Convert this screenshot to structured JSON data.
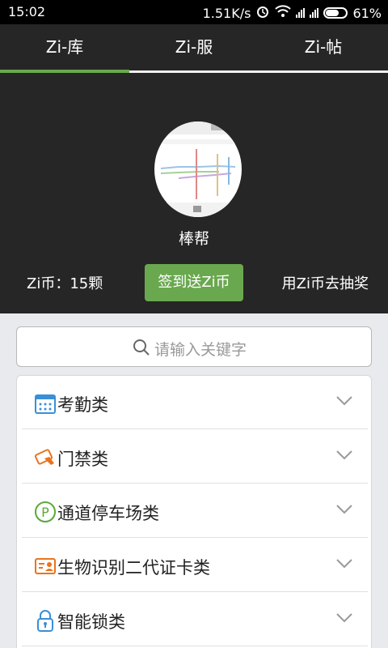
{
  "status_bar": {
    "time": "15:02",
    "speed": "1.51K/s",
    "battery": "61%"
  },
  "tabs": [
    "Zi-库",
    "Zi-服",
    "Zi-帖"
  ],
  "header": {
    "app_name": "棒帮",
    "coin_text": "Zi币：15颗",
    "signin_label": "签到送Zi币",
    "lottery_label": "用Zi币去抽奖"
  },
  "search": {
    "placeholder": "请输入关键字"
  },
  "categories": [
    {
      "label": "考勤类",
      "icon": "calendar-icon"
    },
    {
      "label": "门禁类",
      "icon": "access-card-icon"
    },
    {
      "label": "通道停车场类",
      "icon": "parking-icon"
    },
    {
      "label": "生物识别二代证卡类",
      "icon": "id-card-icon"
    },
    {
      "label": "智能锁类",
      "icon": "lock-icon"
    }
  ],
  "colors": {
    "accent": "#6aa84f",
    "header_bg": "#262626",
    "icon_blue": "#3a8fd8",
    "icon_orange": "#e8741f",
    "icon_green": "#5aa93a"
  }
}
